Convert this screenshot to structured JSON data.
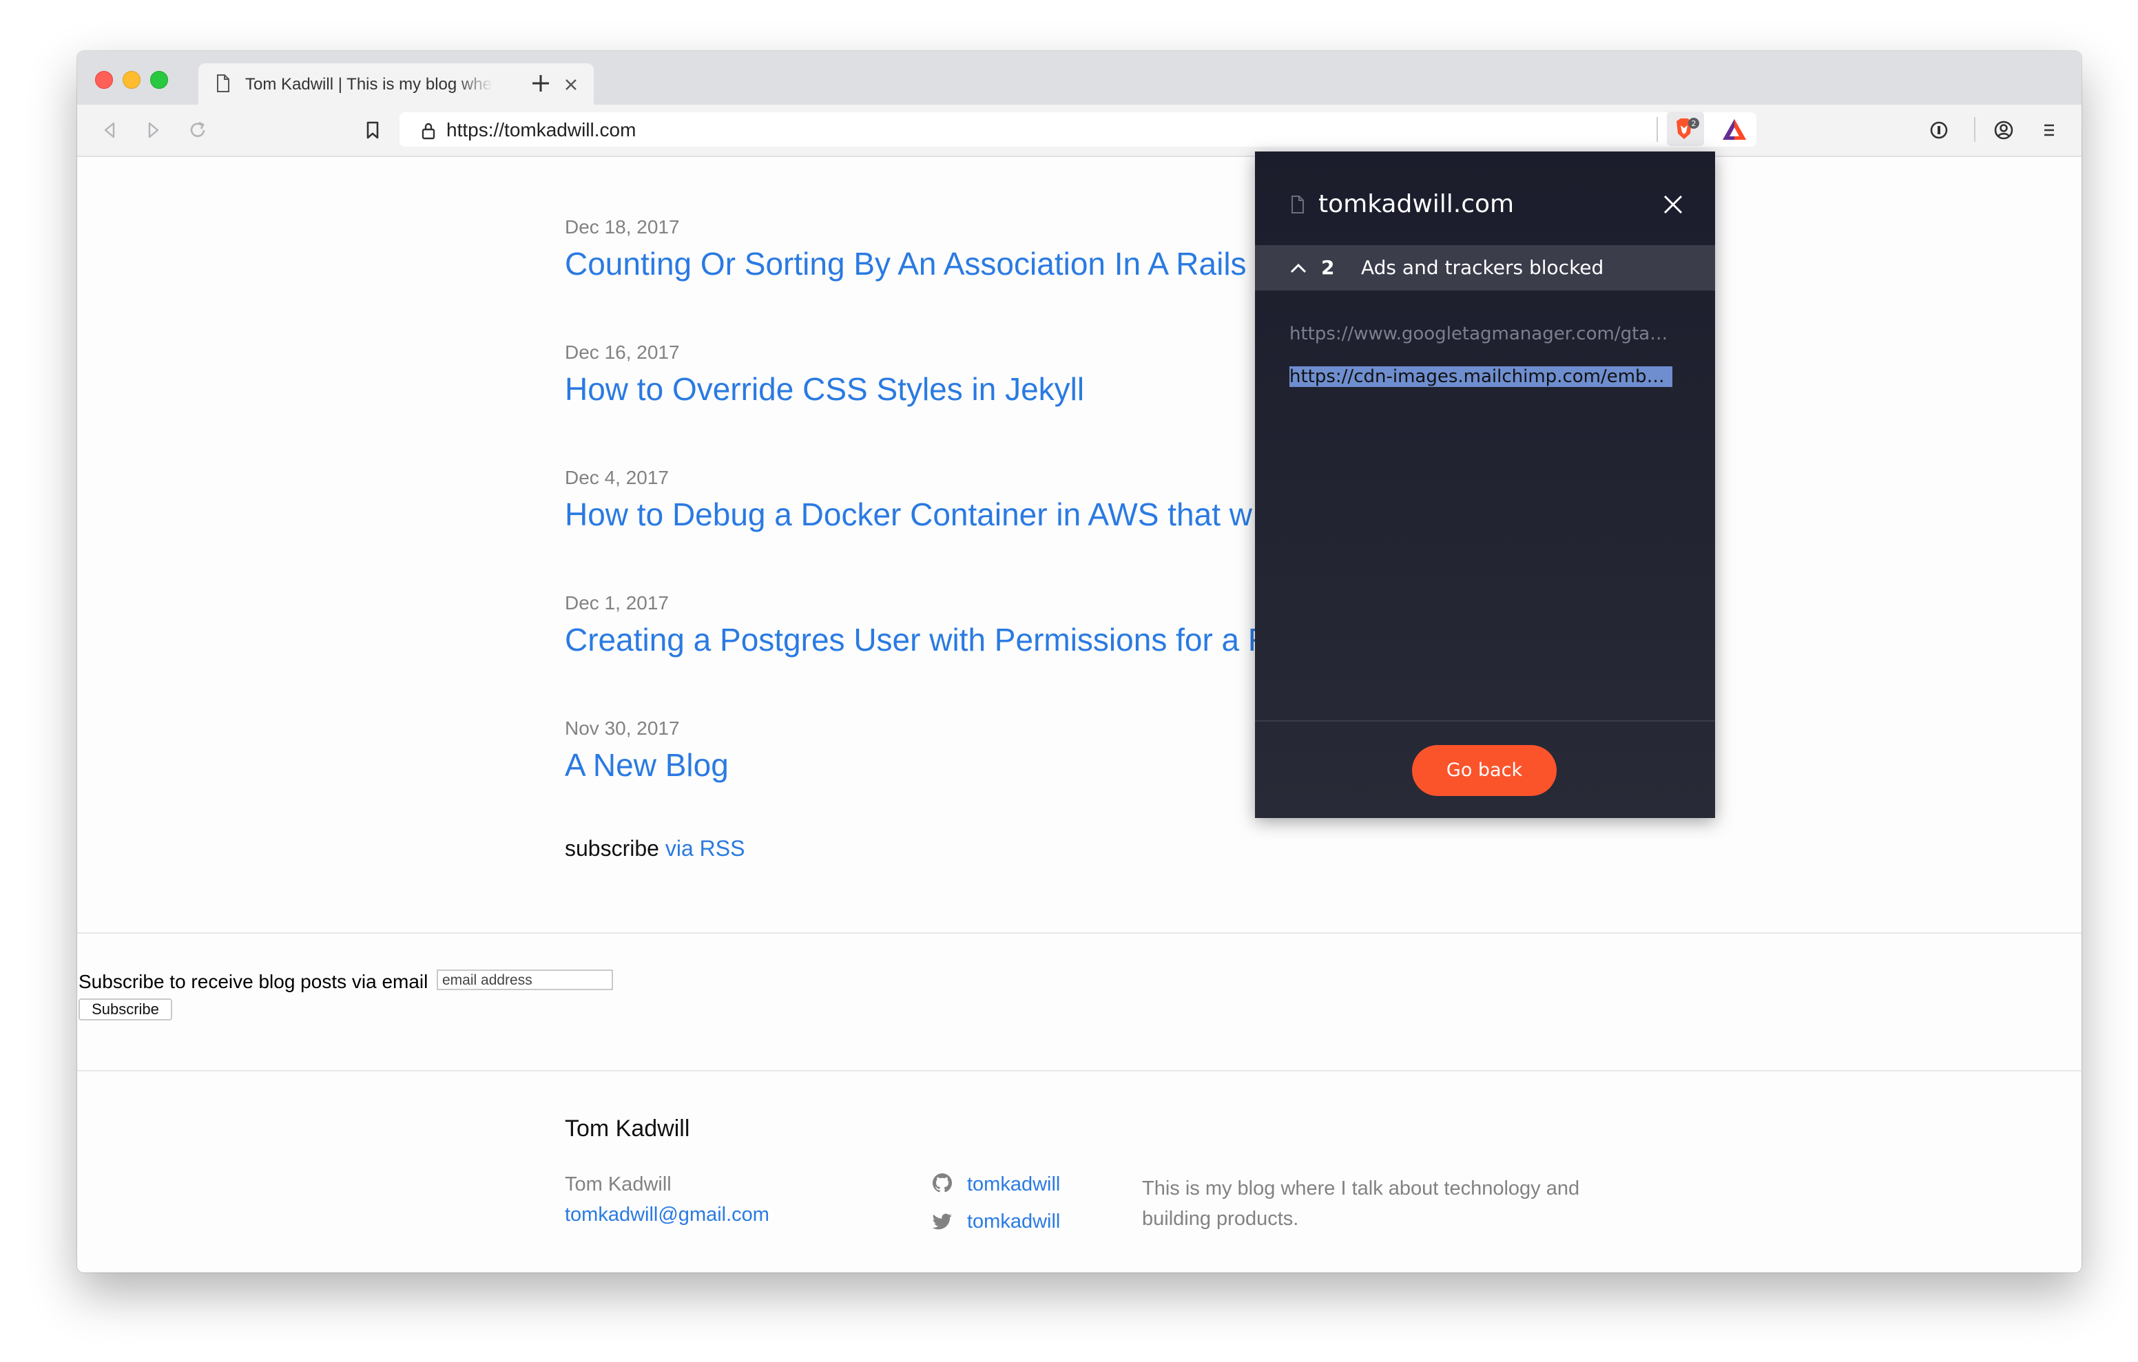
{
  "browser": {
    "tab_title": "Tom Kadwill | This is my blog where I talk about technology",
    "url": "https://tomkadwill.com",
    "shield_badge_count": "2"
  },
  "posts": [
    {
      "date": "Dec 18, 2017",
      "title": "Counting Or Sorting By An Association In A Rails"
    },
    {
      "date": "Dec 16, 2017",
      "title": "How to Override CSS Styles in Jekyll"
    },
    {
      "date": "Dec 4, 2017",
      "title": "How to Debug a Docker Container in AWS that w"
    },
    {
      "date": "Dec 1, 2017",
      "title": "Creating a Postgres User with Permissions for a F"
    },
    {
      "date": "Nov 30, 2017",
      "title": "A New Blog"
    }
  ],
  "subscribe": {
    "prefix": "subscribe",
    "link": "via RSS"
  },
  "mailchimp": {
    "label": "Subscribe to receive blog posts via email",
    "placeholder": "email address",
    "button": "Subscribe"
  },
  "footer": {
    "title": "Tom Kadwill",
    "name": "Tom Kadwill",
    "email": "tomkadwill@gmail.com",
    "github": "tomkadwill",
    "twitter": "tomkadwill",
    "description": "This is my blog where I talk about technology and building products."
  },
  "shields_panel": {
    "site": "tomkadwill.com",
    "blocked_count": "2",
    "blocked_label": "Ads and trackers blocked",
    "blocked_urls": [
      "https://www.googletagmanager.com/gtag/js",
      "https://cdn-images.mailchimp.com/embedcode"
    ],
    "go_back": "Go back"
  },
  "colors": {
    "link": "#2a7ae2",
    "brave_orange": "#fb542b",
    "panel_bg": "#1b1d2c"
  },
  "icons": [
    "document-icon",
    "close-icon",
    "plus-icon",
    "back-icon",
    "forward-icon",
    "reload-icon",
    "bookmark-icon",
    "lock-icon",
    "brave-shield-icon",
    "bat-rewards-icon",
    "password-manager-icon",
    "account-icon",
    "menu-icon",
    "chevron-up-icon",
    "github-icon",
    "twitter-icon"
  ]
}
